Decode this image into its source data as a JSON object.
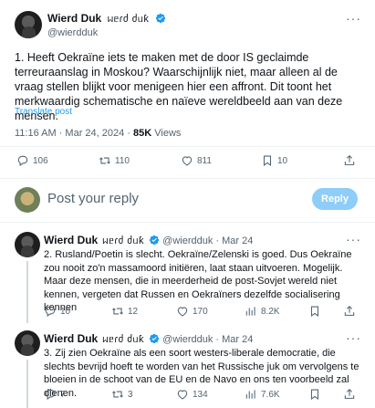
{
  "main_tweet": {
    "author_name": "Wierd Duk",
    "author_script": "ᥕᥱɾძ ძᥙƙ",
    "handle": "@wierdduk",
    "text": "1. Heeft Oekraïne iets te maken met de door IS geclaimde terreuraanslag in Moskou? Waarschijnlijk niet, maar alleen al de vraag stellen blijkt voor menigeen hier een affront. Dit toont het merkwaardig schematische en naïeve wereldbeeld aan van deze mensen.",
    "translate_label": "Translate post",
    "time": "11:16 AM · Mar 24, 2024 · ",
    "views_count": "85K",
    "views_label": " Views",
    "stats": {
      "replies": "106",
      "reposts": "110",
      "likes": "811",
      "bookmarks": "10"
    }
  },
  "reply_box": {
    "placeholder": "Post your reply",
    "button_label": "Reply"
  },
  "replies": [
    {
      "author_name": "Wierd Duk",
      "author_script": "ᥕᥱɾძ ძᥙƙ",
      "handle": "@wierdduk",
      "date": "· Mar 24",
      "text": "2. Rusland/Poetin is slecht. Oekraïne/Zelenski is goed. Dus Oekraïne zou nooit zo'n massamoord  initiëren, laat staan uitvoeren. Mogelijk. Maar deze mensen, die in meerderheid de post-Sovjet wereld niet kennen, vergeten dat Russen en Oekraïners dezelfde socialisering kennen",
      "stats": {
        "replies": "10",
        "reposts": "12",
        "likes": "170",
        "views": "8.2K"
      }
    },
    {
      "author_name": "Wierd Duk",
      "author_script": "ᥕᥱɾძ ძᥙƙ",
      "handle": "@wierdduk",
      "date": "· Mar 24",
      "text": "3. Zij zien Oekraïne als een soort westers-liberale democratie, die slechts bevrijd hoeft te worden van het Russische juk om vervolgens te bloeien in de schoot van de EU en de Navo en ons ten voorbeeld zal dienen.",
      "stats": {
        "replies": "7",
        "reposts": "3",
        "likes": "134",
        "views": "7.6K"
      }
    }
  ],
  "colors": {
    "accent": "#1d9bf0",
    "reply_button_bg": "#8ecdf8",
    "muted_text": "#536471",
    "divider": "#eff3f4"
  },
  "icons": [
    "verified-badge-icon",
    "more-icon",
    "reply-icon",
    "repost-icon",
    "like-icon",
    "bookmark-icon",
    "views-icon",
    "share-icon"
  ]
}
